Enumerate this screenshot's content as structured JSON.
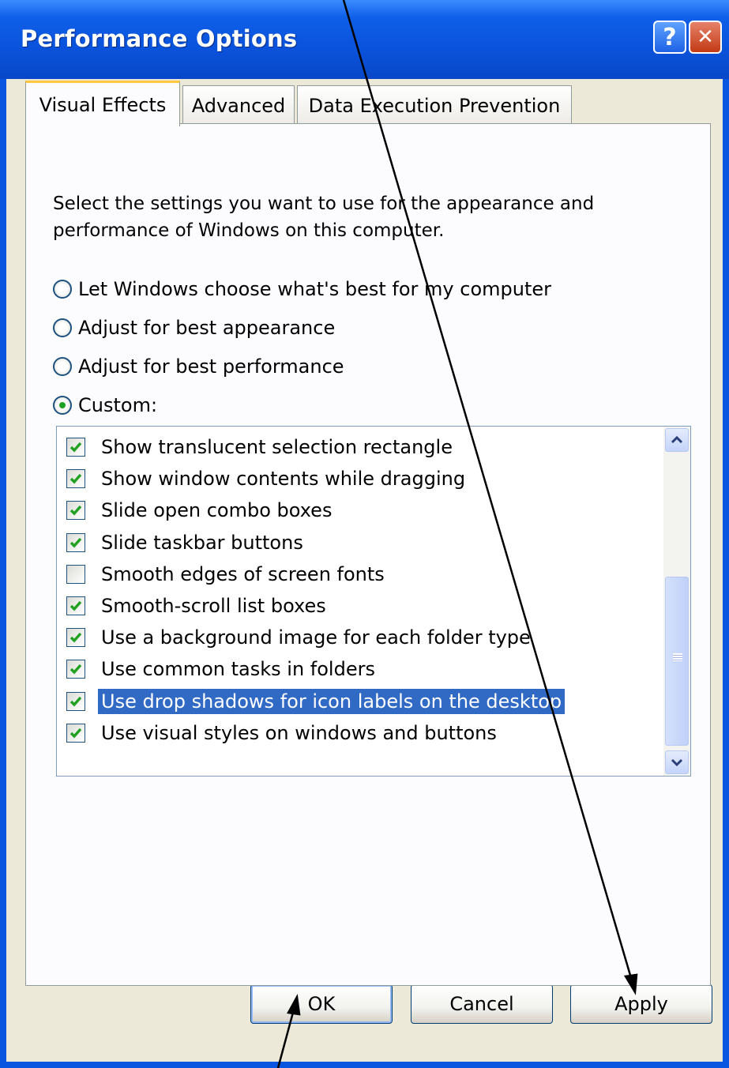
{
  "window": {
    "title": "Performance Options",
    "help_glyph": "?",
    "close_glyph": "✕",
    "colors": {
      "titlebar": "#0a53dc",
      "selection": "#316ac5",
      "check": "#21a121"
    }
  },
  "tabs": [
    {
      "label": "Visual Effects",
      "active": true
    },
    {
      "label": "Advanced",
      "active": false
    },
    {
      "label": "Data Execution Prevention",
      "active": false
    }
  ],
  "description": "Select the settings you want to use for the appearance and performance of Windows on this computer.",
  "radios": [
    {
      "label": "Let Windows choose what's best for my computer",
      "checked": false
    },
    {
      "label": "Adjust for best appearance",
      "checked": false
    },
    {
      "label": "Adjust for best performance",
      "checked": false
    },
    {
      "label": "Custom:",
      "checked": true
    }
  ],
  "list_items": [
    {
      "label": "Show translucent selection rectangle",
      "checked": true,
      "selected": false
    },
    {
      "label": "Show window contents while dragging",
      "checked": true,
      "selected": false
    },
    {
      "label": "Slide open combo boxes",
      "checked": true,
      "selected": false
    },
    {
      "label": "Slide taskbar buttons",
      "checked": true,
      "selected": false
    },
    {
      "label": "Smooth edges of screen fonts",
      "checked": false,
      "selected": false
    },
    {
      "label": "Smooth-scroll list boxes",
      "checked": true,
      "selected": false
    },
    {
      "label": "Use a background image for each folder type",
      "checked": true,
      "selected": false
    },
    {
      "label": "Use common tasks in folders",
      "checked": true,
      "selected": false
    },
    {
      "label": "Use drop shadows for icon labels on the desktop",
      "checked": true,
      "selected": true
    },
    {
      "label": "Use visual styles on windows and buttons",
      "checked": true,
      "selected": false
    }
  ],
  "buttons": {
    "ok": "OK",
    "cancel": "Cancel",
    "apply": "Apply"
  }
}
